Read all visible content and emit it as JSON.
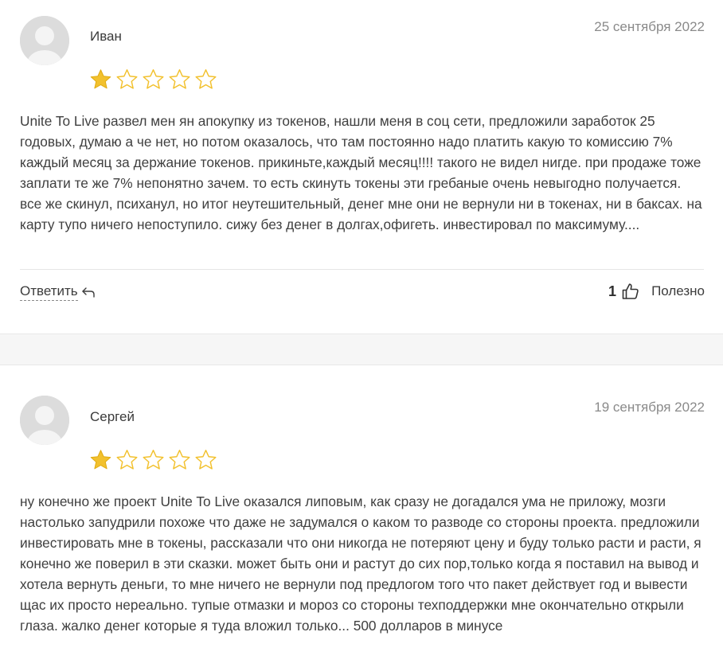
{
  "colors": {
    "star_filled": "#f2c12e",
    "star_empty_outline": "#f2c12e",
    "avatar_bg": "#dcdcdc"
  },
  "reviews": [
    {
      "author": "Иван",
      "date": "25 сентября 2022",
      "rating": 1,
      "max_rating": 5,
      "text": "Unite To Live развел мен ян апокупку из токенов, нашли меня в соц сети, предложили заработок 25 годовых, думаю а че нет, но потом оказалось, что там постоянно надо платить какую то комиссию 7% каждый месяц за держание токенов. прикиньте,каждый месяц!!!! такого не видел нигде. при продаже тоже заплати те же 7% непонятно зачем. то есть скинуть токены эти гребаные очень невыгодно получается. все же скинул, психанул, но итог неутешительный, денег мне они не вернули ни в токенах, ни в баксах. на карту тупо ничего непоступило. сижу без денег в долгах,офигеть. инвестировал по максимуму....",
      "reply_label": "Ответить",
      "useful_count": "1",
      "useful_label": "Полезно"
    },
    {
      "author": "Сергей",
      "date": "19 сентября 2022",
      "rating": 1,
      "max_rating": 5,
      "text": "ну конечно же проект Unite To Live оказался липовым, как сразу не догадался ума не приложу, мозги настолько запудрили похоже что даже не задумался о каком то разводе со стороны проекта. предложили инвестировать мне в токены, рассказали что они никогда не потеряют цену и буду только расти и расти, я конечно же поверил в эти сказки. может быть они и растут до сих пор,только когда я поставил на вывод и хотела вернуть деньги, то мне ничего не вернули под предлогом того что пакет действует год и вывести щас их просто нереально. тупые отмазки и мороз со стороны техподдержки мне окончательно открыли глаза. жалко денег которые я туда вложил только... 500 долларов в минусе"
    }
  ]
}
